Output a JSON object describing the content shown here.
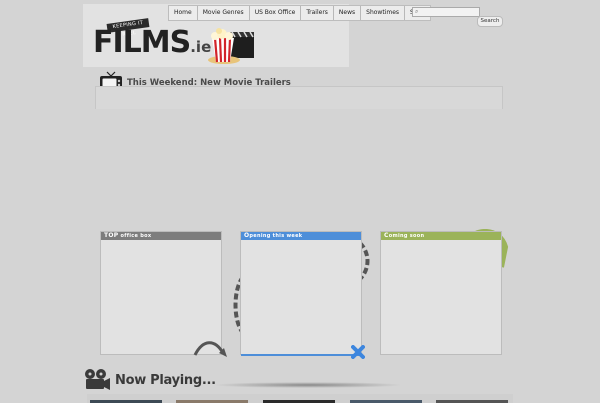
{
  "nav": {
    "items": [
      "Home",
      "Movie Genres",
      "US Box Office",
      "Trailers",
      "News",
      "Showtimes",
      "Shop"
    ],
    "search_button": "Search"
  },
  "logo": {
    "tagline": "KEEPING IT REEL",
    "name": "FILMS",
    "suffix": ".ie"
  },
  "trailers": {
    "title": "This Weekend: New Movie Trailers"
  },
  "boxes": [
    {
      "label_big": "TOP",
      "label": "office box",
      "color": "#7d7d7d"
    },
    {
      "label_big": "O",
      "label": "pening this week",
      "color": "#4d8ed9"
    },
    {
      "label_big": "C",
      "label": "oming soon",
      "color": "#9bb35a"
    }
  ],
  "now_playing": {
    "title": "Now Playing..."
  },
  "colors": {
    "background": "#d4d4d4",
    "blue_accent": "#4d8ed9",
    "green_accent": "#9bb35a"
  },
  "icons": {
    "tv": "tv-icon",
    "projector": "film-projector-icon",
    "popcorn": "popcorn-clapper-icon",
    "search": "search-icon"
  }
}
